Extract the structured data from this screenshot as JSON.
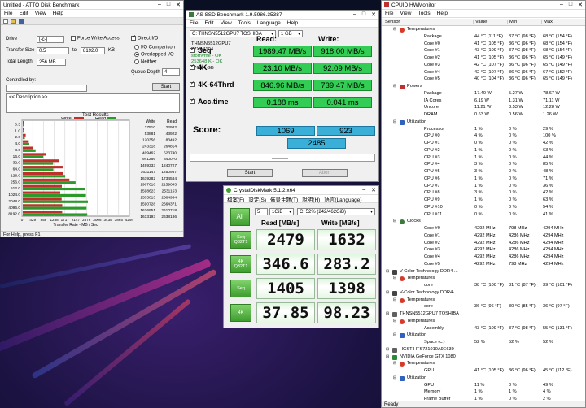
{
  "atto": {
    "title": "Untitled - ATTO Disk Benchmark",
    "menu": [
      "File",
      "Edit",
      "View",
      "Help"
    ],
    "drive_label": "Drive",
    "drive_value": "[-c-]",
    "force_write_label": "Force Write Access",
    "direct_io_label": "Direct I/O",
    "transfer_size_label": "Transfer Size",
    "transfer_from": "0.5",
    "transfer_to": "8192.0",
    "transfer_unit": "KB",
    "io_comparison": "I/O Comparison",
    "overlapped_io": "Overlapped I/O",
    "neither": "Neither",
    "total_length_label": "Total Length",
    "total_length_value": "256 MB",
    "queue_depth_label": "Queue Depth",
    "queue_depth_value": "4",
    "controlled_by_label": "Controlled by:",
    "start_label": "Start",
    "description": "<< Description >>",
    "test_results_label": "Test Results",
    "legend_write": "Write",
    "legend_read": "Read",
    "status": "For Help, press F1"
  },
  "atto_chart": {
    "chart_data": {
      "type": "bar",
      "categories": [
        "0.5",
        "1.0",
        "2.0",
        "4.0",
        "8.0",
        "16.0",
        "32.0",
        "64.0",
        "128.0",
        "256.0",
        "512.0",
        "1024.0",
        "2048.0",
        "4096.0",
        "8192.0"
      ],
      "series": [
        {
          "name": "Write",
          "values": [
            27510,
            53881,
            120356,
            243318,
            409462,
            941266,
            1499333,
            1631147,
            1639282,
            1907616,
            1598623,
            1533013,
            1590728,
            1616951,
            1613193
          ]
        },
        {
          "name": "Read",
          "values": [
            22982,
            43922,
            83492,
            264814,
            523740,
            840070,
            1240727,
            1250957,
            1734584,
            2159043,
            2531153,
            2584934,
            2664371,
            2610718,
            2638186
          ]
        }
      ],
      "x_ticks": [
        "0",
        "429",
        "858",
        "1288",
        "1717",
        "2147",
        "2576",
        "3006",
        "3435",
        "3865",
        "4294"
      ],
      "xlabel": "Transfer Rate - MB / Sec",
      "xlim": [
        0,
        4294
      ],
      "col_write": "Write",
      "col_read": "Read"
    }
  },
  "asssd": {
    "title": "AS SSD Benchmark 1.9.5986.35387",
    "menu": [
      "File",
      "Edit",
      "View",
      "Tools",
      "Language",
      "Help"
    ],
    "drive_select": "C: THNSN5512GPU7 TOSHIBA",
    "size_select": "1 GB",
    "info": [
      "THNSN5512GPU7",
      "57XA4104",
      "stornvme - OK",
      "253648 K - OK",
      "476.94 GB"
    ],
    "read_header": "Read:",
    "write_header": "Write:",
    "rows": [
      {
        "label": "Seq",
        "read": "1989.47 MB/s",
        "write": "918.00 MB/s"
      },
      {
        "label": "4K",
        "read": "23.10 MB/s",
        "write": "92.09 MB/s"
      },
      {
        "label": "4K-64Thrd",
        "read": "846.96 MB/s",
        "write": "739.47 MB/s"
      },
      {
        "label": "Acc.time",
        "read": "0.188 ms",
        "write": "0.041 ms"
      }
    ],
    "score_label": "Score:",
    "score_read": "1069",
    "score_write": "923",
    "score_total": "2485",
    "start_label": "Start",
    "abort_label": "Abort"
  },
  "cdm": {
    "title": "CrystalDiskMark 5.1.2 x64",
    "menu": [
      "檔案(F)",
      "設定(S)",
      "佈景主題(T)",
      "說明(H)",
      "語言(Language)"
    ],
    "all_label": "All",
    "count": "5",
    "size": "1GiB",
    "drive": "C: 52% (242/462GiB)",
    "read_header": "Read [MB/s]",
    "write_header": "Write [MB/s]",
    "rows": [
      {
        "btn": "Seq Q32T1",
        "read": "2479",
        "write": "1632"
      },
      {
        "btn": "4K Q32T1",
        "read": "346.6",
        "write": "283.2"
      },
      {
        "btn": "Seq",
        "read": "1405",
        "write": "1398"
      },
      {
        "btn": "4K",
        "read": "37.85",
        "write": "98.23"
      }
    ]
  },
  "hwm": {
    "title": "CPUID HWMonitor",
    "menu": [
      "File",
      "View",
      "Tools",
      "Help"
    ],
    "headers": [
      "Sensor",
      "Value",
      "Min",
      "Max"
    ],
    "rows": [
      {
        "t": "Temperatures",
        "lv": 2,
        "kind": "temp"
      },
      {
        "t": "Package",
        "v": "44 °C (111 °F)",
        "mn": "37 °C (98 °F)",
        "mx": "68 °C (154 °F)",
        "lv": 4
      },
      {
        "t": "Core #0",
        "v": "41 °C (105 °F)",
        "mn": "36 °C (96 °F)",
        "mx": "68 °C (154 °F)",
        "lv": 4
      },
      {
        "t": "Core #1",
        "v": "43 °C (109 °F)",
        "mn": "37 °C (98 °F)",
        "mx": "68 °C (154 °F)",
        "lv": 4
      },
      {
        "t": "Core #2",
        "v": "41 °C (105 °F)",
        "mn": "36 °C (96 °F)",
        "mx": "65 °C (149 °F)",
        "lv": 4
      },
      {
        "t": "Core #3",
        "v": "42 °C (107 °F)",
        "mn": "36 °C (96 °F)",
        "mx": "65 °C (149 °F)",
        "lv": 4
      },
      {
        "t": "Core #4",
        "v": "42 °C (107 °F)",
        "mn": "36 °C (96 °F)",
        "mx": "67 °C (152 °F)",
        "lv": 4
      },
      {
        "t": "Core #5",
        "v": "40 °C (104 °F)",
        "mn": "36 °C (96 °F)",
        "mx": "65 °C (149 °F)",
        "lv": 4
      },
      {
        "t": "Powers",
        "lv": 2,
        "kind": "power"
      },
      {
        "t": "Package",
        "v": "17.40 W",
        "mn": "5.27 W",
        "mx": "78.67 W",
        "lv": 4
      },
      {
        "t": "IA Cores",
        "v": "6.19 W",
        "mn": "1.31 W",
        "mx": "71.11 W",
        "lv": 4
      },
      {
        "t": "Uncore",
        "v": "11.21 W",
        "mn": "3.53 W",
        "mx": "12.28 W",
        "lv": 4
      },
      {
        "t": "DRAM",
        "v": "0.63 W",
        "mn": "0.56 W",
        "mx": "1.26 W",
        "lv": 4
      },
      {
        "t": "Utilization",
        "lv": 2,
        "kind": "util"
      },
      {
        "t": "Processor",
        "v": "1 %",
        "mn": "0 %",
        "mx": "29 %",
        "lv": 4
      },
      {
        "t": "CPU #0",
        "v": "4 %",
        "mn": "0 %",
        "mx": "100 %",
        "lv": 4
      },
      {
        "t": "CPU #1",
        "v": "0 %",
        "mn": "0 %",
        "mx": "42 %",
        "lv": 4
      },
      {
        "t": "CPU #2",
        "v": "1 %",
        "mn": "0 %",
        "mx": "63 %",
        "lv": 4
      },
      {
        "t": "CPU #3",
        "v": "1 %",
        "mn": "0 %",
        "mx": "44 %",
        "lv": 4
      },
      {
        "t": "CPU #4",
        "v": "3 %",
        "mn": "0 %",
        "mx": "85 %",
        "lv": 4
      },
      {
        "t": "CPU #5",
        "v": "3 %",
        "mn": "0 %",
        "mx": "48 %",
        "lv": 4
      },
      {
        "t": "CPU #6",
        "v": "1 %",
        "mn": "0 %",
        "mx": "71 %",
        "lv": 4
      },
      {
        "t": "CPU #7",
        "v": "1 %",
        "mn": "0 %",
        "mx": "36 %",
        "lv": 4
      },
      {
        "t": "CPU #8",
        "v": "3 %",
        "mn": "0 %",
        "mx": "42 %",
        "lv": 4
      },
      {
        "t": "CPU #9",
        "v": "1 %",
        "mn": "0 %",
        "mx": "63 %",
        "lv": 4
      },
      {
        "t": "CPU #10",
        "v": "0 %",
        "mn": "0 %",
        "mx": "54 %",
        "lv": 4
      },
      {
        "t": "CPU #11",
        "v": "0 %",
        "mn": "0 %",
        "mx": "41 %",
        "lv": 4
      },
      {
        "t": "Clocks",
        "lv": 2,
        "kind": "clock"
      },
      {
        "t": "Core #0",
        "v": "4292 MHz",
        "mn": "798 MHz",
        "mx": "4294 MHz",
        "lv": 4
      },
      {
        "t": "Core #1",
        "v": "4292 MHz",
        "mn": "4286 MHz",
        "mx": "4294 MHz",
        "lv": 4
      },
      {
        "t": "Core #2",
        "v": "4292 MHz",
        "mn": "4286 MHz",
        "mx": "4294 MHz",
        "lv": 4
      },
      {
        "t": "Core #3",
        "v": "4292 MHz",
        "mn": "4286 MHz",
        "mx": "4294 MHz",
        "lv": 4
      },
      {
        "t": "Core #4",
        "v": "4292 MHz",
        "mn": "4286 MHz",
        "mx": "4294 MHz",
        "lv": 4
      },
      {
        "t": "Core #5",
        "v": "4292 MHz",
        "mn": "798 MHz",
        "mx": "4294 MHz",
        "lv": 4
      },
      {
        "t": "V-Color Technology DDR4-...",
        "lv": 1,
        "kind": "chip"
      },
      {
        "t": "Temperatures",
        "lv": 2,
        "kind": "temp"
      },
      {
        "t": "core",
        "v": "38 °C (100 °F)",
        "mn": "31 °C (87 °F)",
        "mx": "39 °C (101 °F)",
        "lv": 4
      },
      {
        "t": "V-Color Technology DDR4-...",
        "lv": 1,
        "kind": "chip"
      },
      {
        "t": "Temperatures",
        "lv": 2,
        "kind": "temp"
      },
      {
        "t": "core",
        "v": "36 °C (96 °F)",
        "mn": "30 °C (85 °F)",
        "mx": "36 °C (97 °F)",
        "lv": 4
      },
      {
        "t": "THNSN5512GPU7 TOSHIBA",
        "lv": 1,
        "kind": "drive"
      },
      {
        "t": "Temperatures",
        "lv": 2,
        "kind": "temp"
      },
      {
        "t": "Assembly",
        "v": "43 °C (109 °F)",
        "mn": "37 °C (98 °F)",
        "mx": "55 °C (131 °F)",
        "lv": 4
      },
      {
        "t": "Utilization",
        "lv": 2,
        "kind": "util"
      },
      {
        "t": "Space (c:)",
        "v": "52 %",
        "mn": "52 %",
        "mx": "52 %",
        "lv": 4
      },
      {
        "t": "HGST HTS721010A9E630",
        "lv": 1,
        "kind": "drive"
      },
      {
        "t": "NVIDIA GeForce GTX 1080",
        "lv": 1,
        "kind": "gpu"
      },
      {
        "t": "Temperatures",
        "lv": 2,
        "kind": "temp"
      },
      {
        "t": "GPU",
        "v": "41 °C (105 °F)",
        "mn": "36 °C (96 °F)",
        "mx": "45 °C (112 °F)",
        "lv": 4
      },
      {
        "t": "Utilization",
        "lv": 2,
        "kind": "util"
      },
      {
        "t": "GPU",
        "v": "11 %",
        "mn": "0 %",
        "mx": "49 %",
        "lv": 4
      },
      {
        "t": "Memory",
        "v": "1 %",
        "mn": "1 %",
        "mx": "4 %",
        "lv": 4
      },
      {
        "t": "Frame Buffer",
        "v": "1 %",
        "mn": "0 %",
        "mx": "2 %",
        "lv": 4
      }
    ],
    "status": "Ready",
    "colors": {
      "temp": "#d83a2a",
      "power": "#c03030",
      "util": "#3060c0",
      "clock": "#3a7a3a",
      "chip": "#444444",
      "drive": "#606060",
      "gpu": "#2a8a3a"
    }
  }
}
